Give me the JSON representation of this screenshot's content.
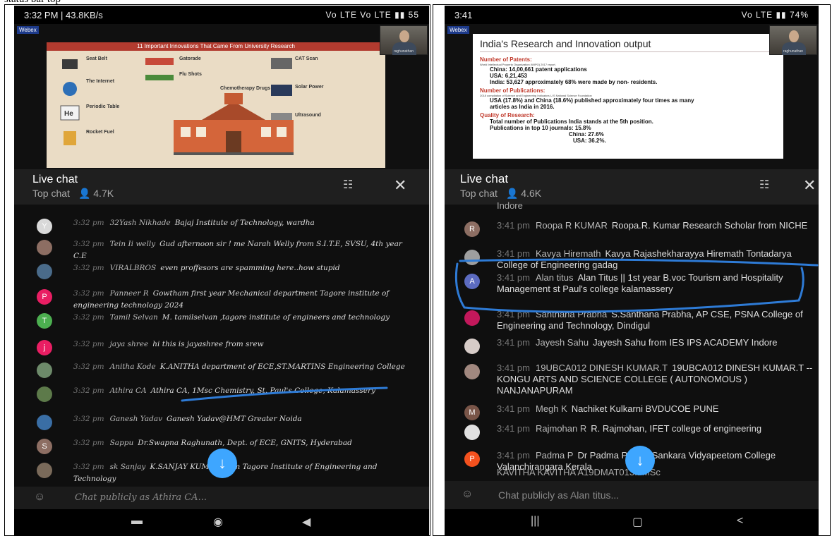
{
  "doc_top": "status bar top edge",
  "left": {
    "status": {
      "time": "3:32 PM | 43.8KB/s",
      "right": "Vo LTE Vo LTE ▮▮ 55"
    },
    "slide": {
      "title": "11 Important Innovations That Came From University Research",
      "items": [
        "Seat Belt",
        "The Internet",
        "Periodic Table",
        "Rocket Fuel",
        "Gatorade",
        "Flu Shots",
        "Chemotherapy Drugs",
        "CAT Scan",
        "Solar Power",
        "Ultrasound"
      ]
    },
    "cam_name": "raghunathan",
    "chat": {
      "title": "Live chat",
      "mode": "Top chat",
      "viewers": "4.7K"
    },
    "messages": [
      {
        "time": "3:32 pm",
        "name": "32Yash Nikhade",
        "text": "Bajaj Institute of Technology, wardha",
        "avatar": "Y",
        "color": "#d9d9d9"
      },
      {
        "time": "3:32 pm",
        "name": "Tein Ii welly",
        "text": "Gud afternoon sir ! me Narah Welly from S.I.T.E, SVSU, 4th year C.E",
        "avatar": "",
        "color": "#8d6e63"
      },
      {
        "time": "3:32 pm",
        "name": "VIRALBROS",
        "text": "even proffesors are spamming here..how stupid",
        "avatar": "",
        "color": "#4a6b8a"
      },
      {
        "time": "3:32 pm",
        "name": "Panneer R",
        "text": "Gowtham first year Mechanical department Tagore institute of engineering technology 2024",
        "avatar": "P",
        "color": "#e91e63"
      },
      {
        "time": "3:32 pm",
        "name": "Tamil Selvan",
        "text": "M. tamilselvan ,tagore institute of engineers and technology",
        "avatar": "T",
        "color": "#4caf50"
      },
      {
        "time": "3:32 pm",
        "name": "jaya shree",
        "text": "hi this is jayashree from srew",
        "avatar": "j",
        "color": "#e91e63"
      },
      {
        "time": "3:32 pm",
        "name": "Anitha Kode",
        "text": "K.ANITHA department of ECE,ST.MARTINS Engineering College",
        "avatar": "",
        "color": "#6d8a6a"
      },
      {
        "time": "3:32 pm",
        "name": "Athira CA",
        "text": "Athira CA, 1Msc Chemistry, St. Paul's College, Kalamassery",
        "avatar": "",
        "color": "#5d7a4a"
      },
      {
        "time": "3:32 pm",
        "name": "Ganesh Yadav",
        "text": "Ganesh Yadav@HMT Greater Noida",
        "avatar": "",
        "color": "#3a6ea5"
      },
      {
        "time": "3:32 pm",
        "name": "Sappu",
        "text": "Dr.Swapna Raghunath, Dept. of ECE, GNITS, Hyderabad",
        "avatar": "S",
        "color": "#8d6e63"
      },
      {
        "time": "3:32 pm",
        "name": "sk Sanjay",
        "text": "K.SANJAY KUMAR from Tagore Institute of Engineering and Technology",
        "avatar": "",
        "color": "#7a6a5a"
      }
    ],
    "input_placeholder": "Chat publicly as Athira CA..."
  },
  "right": {
    "status": {
      "time": "3:41",
      "right": "Vo LTE ▮▮ 74%"
    },
    "slide": {
      "title": "India's Research and Innovation output",
      "h1": "Number of Patents:",
      "s1": "World Intellectual Property Organization (WIPO) 2017 report.",
      "l1": [
        "China: 14,00,661 patent applications",
        "USA: 6,21,453",
        "India: 53,627 approximately 68% were made by non- residents."
      ],
      "h2": "Number of Publications:",
      "s2": "2018 compilation of Science and Engineering Indicators U.S National Science Foundation",
      "l2": [
        "USA (17.8%) and China (18.6%) published approximately four times as many",
        "articles as India in 2016."
      ],
      "h3": "Quality of Research:",
      "l3": [
        "Total number of Publications India stands at the 5th position.",
        "Publications in top 10 journals:   15.8%",
        "China:   27.6%",
        "USA:   36.2%."
      ]
    },
    "cam_name": "raghunathan",
    "chat": {
      "title": "Live chat",
      "mode": "Top chat",
      "viewers": "4.6K"
    },
    "top_partial": "Indore",
    "messages": [
      {
        "time": "3:41 pm",
        "name": "Roopa R KUMAR",
        "text": "Roopa.R. Kumar Research Scholar from NICHE",
        "avatar": "R",
        "color": "#8d6e63"
      },
      {
        "time": "3:41 pm",
        "name": "Kavya Hiremath",
        "text": "Kavya Rajashekharayya Hiremath Tontadarya College of Engineering gadag",
        "avatar": "",
        "color": "#9e9e9e"
      },
      {
        "time": "3:41 pm",
        "name": "Alan titus",
        "text": "Alan Titus || 1st year B.voc Tourism and Hospitality Management st Paul's college kalamassery",
        "avatar": "A",
        "color": "#5c6bc0"
      },
      {
        "time": "3:41 pm",
        "name": "Santhana Prabha",
        "text": "S.Santhana Prabha, AP CSE, PSNA College of Engineering and Technology, Dindigul",
        "avatar": "",
        "color": "#c2185b"
      },
      {
        "time": "3:41 pm",
        "name": "Jayesh Sahu",
        "text": "Jayesh Sahu from IES IPS ACADEMY Indore",
        "avatar": "",
        "color": "#d7ccc8"
      },
      {
        "time": "3:41 pm",
        "name": "19UBCA012 DINESH KUMAR.T",
        "text": "19UBCA012 DINESH KUMAR.T -- KONGU ARTS AND SCIENCE COLLEGE ( AUTONOMOUS ) NANJANAPURAM",
        "avatar": "",
        "color": "#a1887f"
      },
      {
        "time": "3:41 pm",
        "name": "Megh K",
        "text": "Nachiket Kulkarni BVDUCOE PUNE",
        "avatar": "M",
        "color": "#795548"
      },
      {
        "time": "3:41 pm",
        "name": "Rajmohan R",
        "text": "R. Rajmohan, IFET college of engineering",
        "avatar": "",
        "color": "#e0e0e0"
      },
      {
        "time": "3:41 pm",
        "name": "Padma P",
        "text": "Dr Padma P Sree Sankara Vidyapeetom College Valanchirangara Kerala",
        "avatar": "P",
        "color": "#f4511e"
      }
    ],
    "bottom_partial": "KAVITHA KAVITHA A19DMAT013II MSc",
    "input_placeholder": "Chat publicly as Alan titus..."
  }
}
